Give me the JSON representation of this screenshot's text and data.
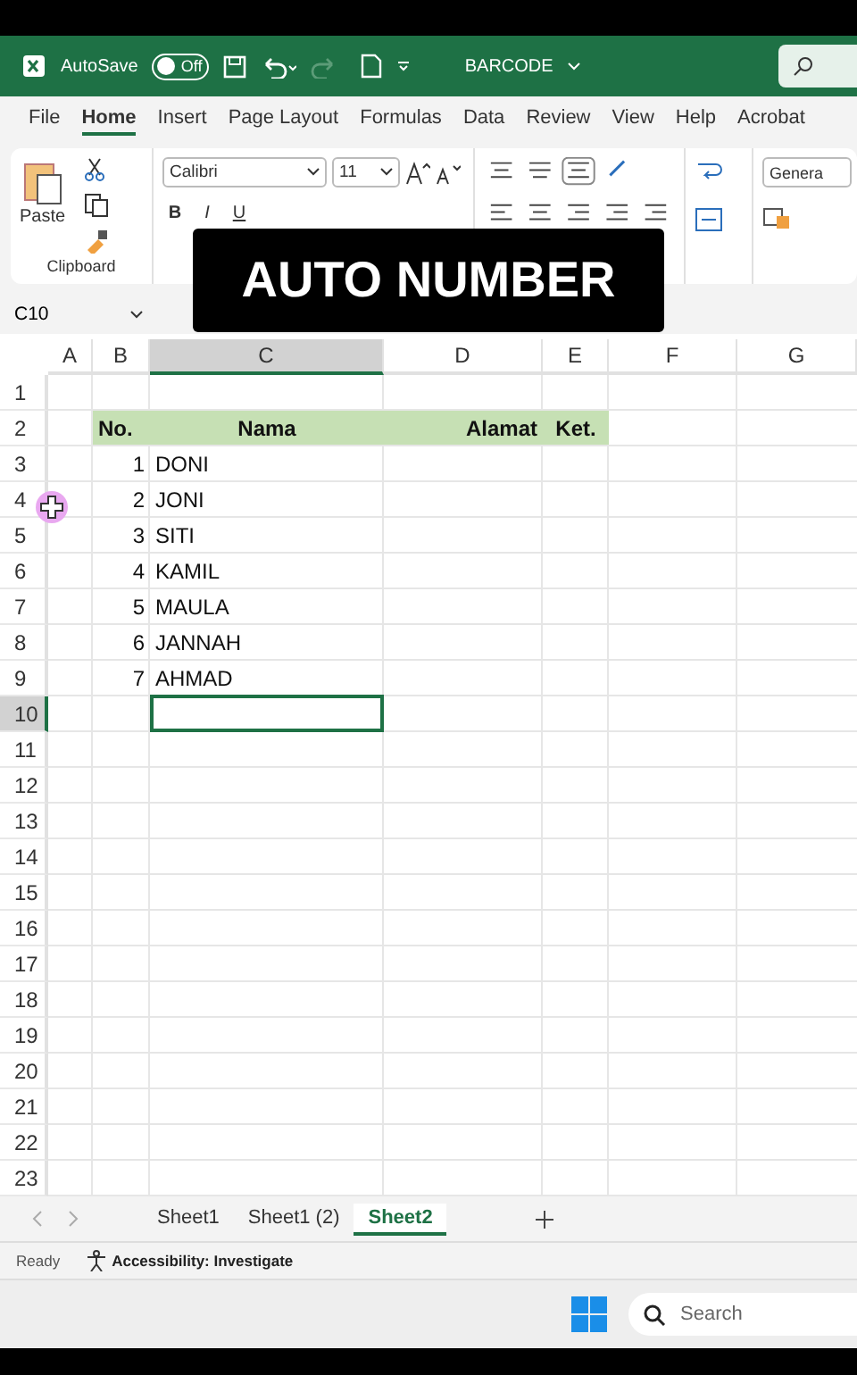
{
  "title_bar": {
    "autosave_label": "AutoSave",
    "autosave": {
      "on": false,
      "label": "Off"
    },
    "filename": "BARCODE"
  },
  "ribbon_tabs": [
    {
      "label": "File",
      "selected": false
    },
    {
      "label": "Home",
      "selected": true
    },
    {
      "label": "Insert",
      "selected": false
    },
    {
      "label": "Page Layout",
      "selected": false
    },
    {
      "label": "Formulas",
      "selected": false
    },
    {
      "label": "Data",
      "selected": false
    },
    {
      "label": "Review",
      "selected": false
    },
    {
      "label": "View",
      "selected": false
    },
    {
      "label": "Help",
      "selected": false
    },
    {
      "label": "Acrobat",
      "selected": false
    }
  ],
  "ribbon": {
    "paste_label": "Paste",
    "clipboard_label": "Clipboard",
    "font": "Calibri",
    "font_size": "11",
    "bold": "B",
    "italic": "I",
    "underline": "U",
    "number_format": "Genera"
  },
  "name_box": "C10",
  "overlay_title": "AUTO NUMBER",
  "columns": [
    {
      "label": "A",
      "selected": false
    },
    {
      "label": "B",
      "selected": false
    },
    {
      "label": "C",
      "selected": true
    },
    {
      "label": "D",
      "selected": false
    },
    {
      "label": "E",
      "selected": false
    },
    {
      "label": "F",
      "selected": false
    },
    {
      "label": "G",
      "selected": false
    }
  ],
  "rows": [
    {
      "label": "1",
      "selected": false,
      "kind": "empty"
    },
    {
      "label": "2",
      "selected": false,
      "kind": "header",
      "cells": [
        "No.",
        "Nama",
        "Alamat",
        "Ket."
      ]
    },
    {
      "label": "3",
      "selected": false,
      "kind": "data",
      "cells": [
        "1",
        "DONI"
      ]
    },
    {
      "label": "4",
      "selected": false,
      "kind": "data",
      "cells": [
        "2",
        "JONI"
      ]
    },
    {
      "label": "5",
      "selected": false,
      "kind": "data",
      "cells": [
        "3",
        "SITI"
      ]
    },
    {
      "label": "6",
      "selected": false,
      "kind": "data",
      "cells": [
        "4",
        "KAMIL"
      ]
    },
    {
      "label": "7",
      "selected": false,
      "kind": "data",
      "cells": [
        "5",
        "MAULA"
      ]
    },
    {
      "label": "8",
      "selected": false,
      "kind": "data",
      "cells": [
        "6",
        "JANNAH"
      ]
    },
    {
      "label": "9",
      "selected": false,
      "kind": "data",
      "cells": [
        "7",
        "AHMAD"
      ]
    },
    {
      "label": "10",
      "selected": true,
      "kind": "empty"
    },
    {
      "label": "11",
      "selected": false,
      "kind": "empty"
    },
    {
      "label": "12",
      "selected": false,
      "kind": "empty"
    },
    {
      "label": "13",
      "selected": false,
      "kind": "empty"
    },
    {
      "label": "14",
      "selected": false,
      "kind": "empty"
    },
    {
      "label": "15",
      "selected": false,
      "kind": "empty"
    },
    {
      "label": "16",
      "selected": false,
      "kind": "empty"
    },
    {
      "label": "17",
      "selected": false,
      "kind": "empty"
    },
    {
      "label": "18",
      "selected": false,
      "kind": "empty"
    },
    {
      "label": "19",
      "selected": false,
      "kind": "empty"
    },
    {
      "label": "20",
      "selected": false,
      "kind": "empty"
    },
    {
      "label": "21",
      "selected": false,
      "kind": "empty"
    },
    {
      "label": "22",
      "selected": false,
      "kind": "empty"
    },
    {
      "label": "23",
      "selected": false,
      "kind": "empty"
    }
  ],
  "sheet_tabs": [
    {
      "label": "Sheet1",
      "selected": false
    },
    {
      "label": "Sheet1 (2)",
      "selected": false
    },
    {
      "label": "Sheet2",
      "selected": true
    }
  ],
  "status_bar": {
    "state": "Ready",
    "accessibility": "Accessibility: Investigate"
  },
  "taskbar": {
    "search_placeholder": "Search"
  }
}
